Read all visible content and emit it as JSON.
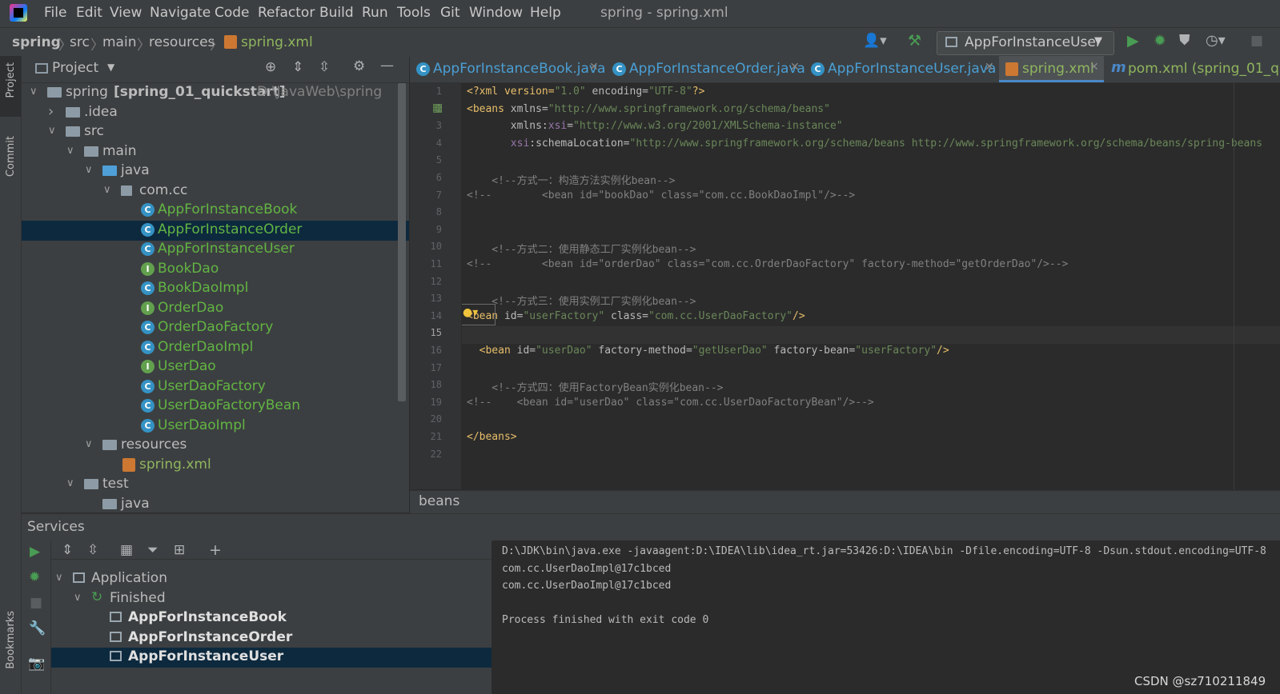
{
  "menubar": {
    "items": [
      "File",
      "Edit",
      "View",
      "Navigate",
      "Code",
      "Refactor",
      "Build",
      "Run",
      "Tools",
      "Git",
      "Window",
      "Help"
    ],
    "window_title": "spring - spring.xml"
  },
  "navbar": {
    "breadcrumbs": [
      "spring",
      "src",
      "main",
      "resources",
      "spring.xml"
    ],
    "run_config": "AppForInstanceUser"
  },
  "left_strip": {
    "project": "Project",
    "commit": "Commit",
    "bookmarks": "Bookmarks"
  },
  "project_panel": {
    "title": "Project",
    "tree": [
      {
        "label": "spring",
        "bold_suffix": "[spring_01_quickstart]",
        "path": "D:\\JavaWeb\\spring",
        "icon": "module-folder-icon",
        "depth": 0,
        "arrow": "expanded"
      },
      {
        "label": ".idea",
        "icon": "folder-icon",
        "depth": 1,
        "arrow": "collapsed"
      },
      {
        "label": "src",
        "icon": "folder-icon",
        "depth": 1,
        "arrow": "expanded"
      },
      {
        "label": "main",
        "icon": "folder-icon",
        "depth": 2,
        "arrow": "expanded"
      },
      {
        "label": "java",
        "icon": "source-folder-icon",
        "depth": 3,
        "arrow": "expanded"
      },
      {
        "label": "com.cc",
        "icon": "package-icon",
        "depth": 4,
        "arrow": "expanded"
      },
      {
        "label": "AppForInstanceBook",
        "icon": "class-run-icon",
        "depth": 5
      },
      {
        "label": "AppForInstanceOrder",
        "icon": "class-run-icon",
        "depth": 5,
        "selected": true
      },
      {
        "label": "AppForInstanceUser",
        "icon": "class-run-icon",
        "depth": 5
      },
      {
        "label": "BookDao",
        "icon": "interface-icon",
        "depth": 5
      },
      {
        "label": "BookDaoImpl",
        "icon": "class-icon",
        "depth": 5
      },
      {
        "label": "OrderDao",
        "icon": "interface-icon",
        "depth": 5
      },
      {
        "label": "OrderDaoFactory",
        "icon": "class-icon",
        "depth": 5
      },
      {
        "label": "OrderDaoImpl",
        "icon": "class-icon",
        "depth": 5
      },
      {
        "label": "UserDao",
        "icon": "interface-icon",
        "depth": 5
      },
      {
        "label": "UserDaoFactory",
        "icon": "class-icon",
        "depth": 5
      },
      {
        "label": "UserDaoFactoryBean",
        "icon": "class-icon",
        "depth": 5
      },
      {
        "label": "UserDaoImpl",
        "icon": "class-icon",
        "depth": 5
      },
      {
        "label": "resources",
        "icon": "resources-folder-icon",
        "depth": 3,
        "arrow": "expanded"
      },
      {
        "label": "spring.xml",
        "icon": "xml-file-icon",
        "depth": 4
      },
      {
        "label": "test",
        "icon": "folder-icon",
        "depth": 2,
        "arrow": "expanded"
      },
      {
        "label": "java",
        "icon": "folder-icon",
        "depth": 3
      }
    ]
  },
  "editor_tabs": [
    {
      "label": "AppForInstanceBook.java",
      "icon": "class-run-icon"
    },
    {
      "label": "AppForInstanceOrder.java",
      "icon": "class-run-icon"
    },
    {
      "label": "AppForInstanceUser.java",
      "icon": "class-run-icon"
    },
    {
      "label": "spring.xml",
      "icon": "xml-file-icon",
      "active": true
    },
    {
      "label": "pom.xml (spring_01_qu",
      "icon": "maven-icon"
    }
  ],
  "code_lines": [
    [
      [
        "<?xml version=",
        "#e8bf6a"
      ],
      [
        "\"1.0\"",
        "#6a8759"
      ],
      [
        " encoding=",
        "#bababa"
      ],
      [
        "\"UTF-8\"",
        "#6a8759"
      ],
      [
        "?>",
        "#e8bf6a"
      ]
    ],
    [
      [
        "<beans ",
        "#e8bf6a"
      ],
      [
        "xmlns=",
        "#bababa"
      ],
      [
        "\"http://www.springframework.org/schema/beans\"",
        "#6a8759"
      ]
    ],
    [
      [
        "       xmlns:",
        "#bababa"
      ],
      [
        "xsi",
        "#9876aa"
      ],
      [
        "=",
        "#bababa"
      ],
      [
        "\"http://www.w3.org/2001/XMLSchema-instance\"",
        "#6a8759"
      ]
    ],
    [
      [
        "       ",
        "#bababa"
      ],
      [
        "xsi",
        "#9876aa"
      ],
      [
        ":schemaLocation=",
        "#bababa"
      ],
      [
        "\"http://www.springframework.org/schema/beans http://www.springframework.org/schema/beans/spring-beans",
        "#6a8759"
      ]
    ],
    [],
    [
      [
        "    <!--方式一：构造方法实例化bean-->",
        "#808080"
      ]
    ],
    [
      [
        "<!--        <bean id=\"bookDao\" class=\"com.cc.BookDaoImpl\"/>-->",
        "#808080"
      ]
    ],
    [],
    [],
    [
      [
        "    <!--方式二：使用静态工厂实例化bean-->",
        "#808080"
      ]
    ],
    [
      [
        "<!--        <bean id=\"orderDao\" class=\"com.cc.OrderDaoFactory\" factory-method=\"getOrderDao\"/>-->",
        "#808080"
      ]
    ],
    [],
    [
      [
        "    <!--方式三：使用实例工厂实例化bean-->",
        "#808080"
      ]
    ],
    [
      [
        "<bean",
        "#e8bf6a"
      ],
      [
        " id=",
        "#bababa"
      ],
      [
        "\"userFactory\"",
        "#6a8759"
      ],
      [
        " class=",
        "#bababa"
      ],
      [
        "\"com.cc.UserDaoFactory\"",
        "#6a8759"
      ],
      [
        "/>",
        "#e8bf6a"
      ]
    ],
    [],
    [
      [
        "  <bean ",
        "#e8bf6a"
      ],
      [
        "id=",
        "#bababa"
      ],
      [
        "\"userDao\"",
        "#6a8759"
      ],
      [
        " factory-method=",
        "#bababa"
      ],
      [
        "\"getUserDao\"",
        "#6a8759"
      ],
      [
        " factory-bean=",
        "#bababa"
      ],
      [
        "\"userFactory\"",
        "#6a8759"
      ],
      [
        "/>",
        "#e8bf6a"
      ]
    ],
    [],
    [
      [
        "    <!--方式四：使用FactoryBean实例化bean-->",
        "#808080"
      ]
    ],
    [
      [
        "<!--    <bean id=\"userDao\" class=\"com.cc.UserDaoFactoryBean\"/>-->",
        "#808080"
      ]
    ],
    [],
    [
      [
        "</beans>",
        "#e8bf6a"
      ]
    ],
    []
  ],
  "current_line": 15,
  "editor_breadcrumb": "beans",
  "services": {
    "title": "Services",
    "tree": [
      {
        "label": "Application",
        "icon": "application-icon",
        "depth": 0,
        "arrow": "expanded"
      },
      {
        "label": "Finished",
        "icon": "finished-icon",
        "depth": 1,
        "arrow": "expanded"
      },
      {
        "label": "AppForInstanceBook",
        "icon": "app-config-icon",
        "depth": 2,
        "bold": true
      },
      {
        "label": "AppForInstanceOrder",
        "icon": "app-config-icon",
        "depth": 2,
        "bold": true
      },
      {
        "label": "AppForInstanceUser",
        "icon": "app-config-icon",
        "depth": 2,
        "bold": true,
        "selected": true
      }
    ],
    "console": [
      "D:\\JDK\\bin\\java.exe -javaagent:D:\\IDEA\\lib\\idea_rt.jar=53426:D:\\IDEA\\bin -Dfile.encoding=UTF-8 -Dsun.stdout.encoding=UTF-8",
      "com.cc.UserDaoImpl@17c1bced",
      "com.cc.UserDaoImpl@17c1bced",
      "",
      "Process finished with exit code 0"
    ]
  },
  "watermark": "CSDN @sz710211849",
  "colors": {
    "accent": "#4a88c7",
    "selection": "#0d293e",
    "run_green": "#499c54",
    "class_text": "#62b543"
  }
}
